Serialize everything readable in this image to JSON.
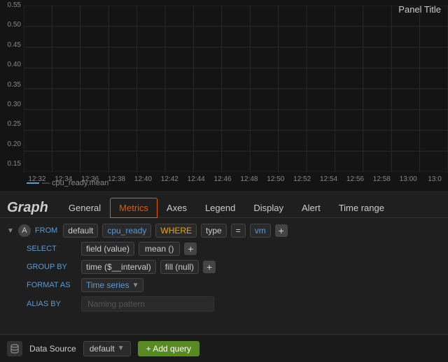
{
  "panel": {
    "title": "Panel Title"
  },
  "chart": {
    "y_labels": [
      "0.55",
      "0.50",
      "0.45",
      "0.40",
      "0.35",
      "0.30",
      "0.25",
      "0.20",
      "0.15"
    ],
    "x_labels": [
      "12:32",
      "12:34",
      "12:36",
      "12:38",
      "12:40",
      "12:42",
      "12:44",
      "12:46",
      "12:48",
      "12:50",
      "12:52",
      "12:54",
      "12:56",
      "12:58",
      "13:00",
      "13:0"
    ],
    "legend": "— cpu_ready.mean"
  },
  "editor": {
    "title": "Graph",
    "tabs": [
      "General",
      "Metrics",
      "Axes",
      "Legend",
      "Display",
      "Alert",
      "Time range"
    ]
  },
  "query": {
    "from_label": "FROM",
    "from_default": "default",
    "from_metric": "cpu_ready",
    "where_label": "WHERE",
    "where_key": "type",
    "where_op": "=",
    "where_val": "vm",
    "select_label": "SELECT",
    "select_field": "field (value)",
    "select_func": "mean ()",
    "group_by_label": "GROUP BY",
    "group_by_time": "time ($__interval)",
    "group_by_fill": "fill (null)",
    "format_as_label": "FORMAT AS",
    "format_as_value": "Time series",
    "alias_by_label": "ALIAS BY",
    "alias_placeholder": "Naming pattern"
  },
  "bottom": {
    "data_source_label": "Data Source",
    "data_source_value": "default",
    "add_query_label": "+ Add query"
  }
}
